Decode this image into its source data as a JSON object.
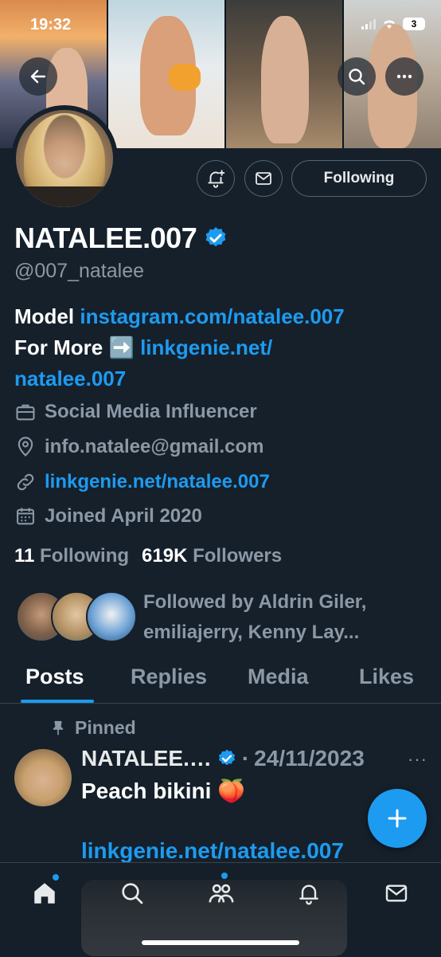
{
  "status_bar": {
    "time": "19:32",
    "battery": "3"
  },
  "profile": {
    "display_name": "NATALEE.007",
    "handle": "@007_natalee",
    "follow_button": "Following",
    "bio": {
      "line1_text": "Model ",
      "line1_link": "instagram.com/natalee.007",
      "line2_text": "For More ",
      "line2_emoji": "➡️",
      "line2_link_a": "linkgenie.net/",
      "line2_link_b": "natalee.007"
    },
    "category": "Social Media Influencer",
    "email": "info.natalee@gmail.com",
    "website": "linkgenie.net/natalee.007",
    "joined": "Joined April 2020",
    "following_count": "11",
    "following_label": "Following",
    "followers_count": "619K",
    "followers_label": "Followers",
    "followed_by_line1": "Followed by Aldrin Giler,",
    "followed_by_line2": "emiliajerry, Kenny Lay..."
  },
  "tabs": [
    {
      "label": "Posts"
    },
    {
      "label": "Replies"
    },
    {
      "label": "Media"
    },
    {
      "label": "Likes"
    }
  ],
  "post": {
    "pinned_label": "Pinned",
    "author": "NATALEE.…",
    "separator": "·",
    "date": "24/11/2023",
    "more": "···",
    "text": "Peach bikini 🍑",
    "link": "linkgenie.net/natalee.007"
  },
  "colors": {
    "accent": "#1d9bf0",
    "background": "#15202b",
    "muted": "#8b98a5"
  },
  "icons": {
    "back": "arrow-left-icon",
    "search": "search-icon",
    "more": "more-icon",
    "notify": "bell-plus-icon",
    "message": "envelope-icon",
    "verified": "verified-badge-icon",
    "briefcase": "briefcase-icon",
    "location": "location-pin-icon",
    "link": "link-icon",
    "calendar": "calendar-icon",
    "pin": "pin-icon",
    "compose": "plus-icon",
    "nav": [
      "home-icon",
      "search-icon",
      "communities-icon",
      "bell-icon",
      "mail-icon"
    ]
  }
}
